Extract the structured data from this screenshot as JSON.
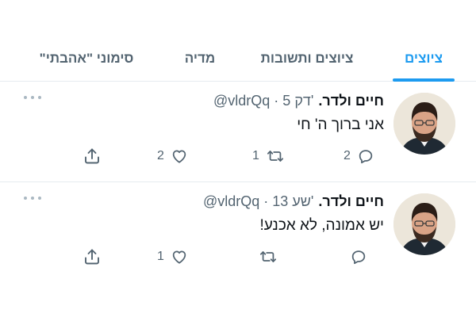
{
  "tabs": [
    {
      "label": "ציוצים",
      "active": true
    },
    {
      "label": "ציוצים ותשובות",
      "active": false
    },
    {
      "label": "מדיה",
      "active": false
    },
    {
      "label": "סימוני \"אהבתי\"",
      "active": false
    }
  ],
  "tweets": [
    {
      "author": "חיים ולדר.",
      "handle": "@vldrQq",
      "separator": "·",
      "time": "5 דק'",
      "text": "אני ברוך ה' חי",
      "replies": "2",
      "retweets": "1",
      "likes": "2",
      "share": ""
    },
    {
      "author": "חיים ולדר.",
      "handle": "@vldrQq",
      "separator": "·",
      "time": "13 שע'",
      "text": "יש אמונה, לא אכנע!",
      "replies": "",
      "retweets": "",
      "likes": "1",
      "share": ""
    }
  ],
  "colors": {
    "accent": "#1d9bf0",
    "secondary_text": "#536471",
    "divider": "#e6ecf0"
  },
  "icons": {
    "reply": "reply-icon",
    "retweet": "retweet-icon",
    "like": "heart-icon",
    "share": "share-icon",
    "more": "more-icon"
  }
}
